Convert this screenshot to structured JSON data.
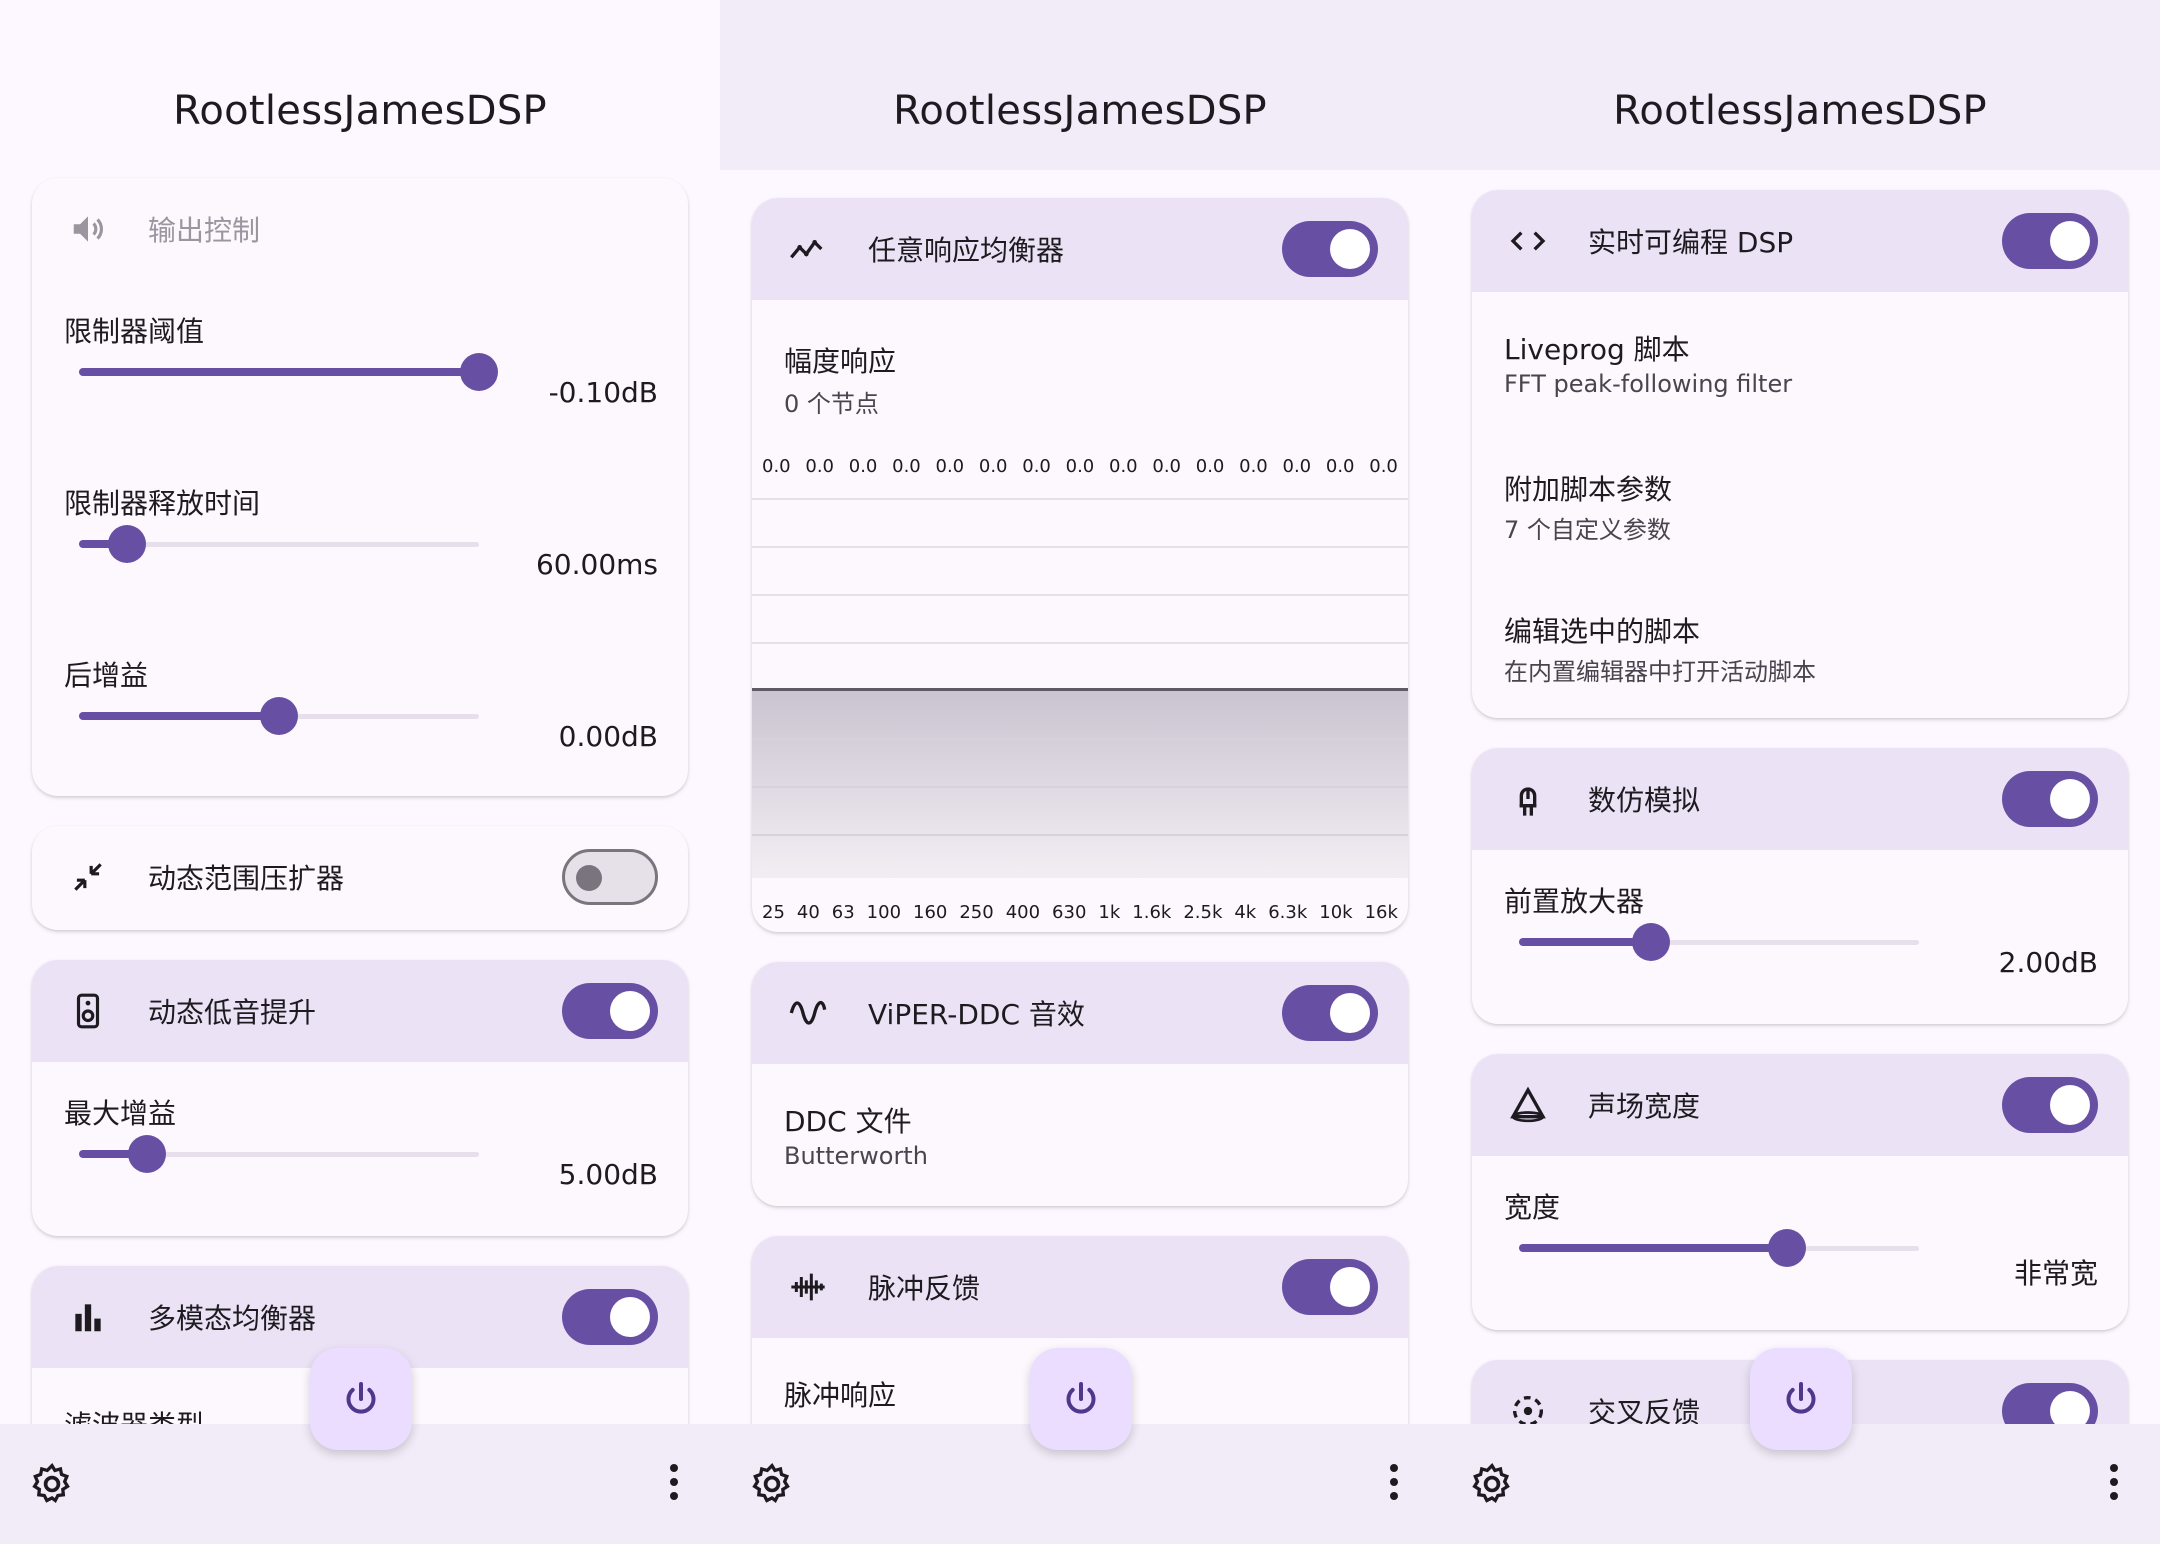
{
  "app_title": "RootlessJamesDSP",
  "panel1": {
    "output_card": {
      "title": "输出控制",
      "limiter_threshold": {
        "label": "限制器阈值",
        "value": "-0.10dB",
        "fraction": 1.0
      },
      "limiter_release": {
        "label": "限制器释放时间",
        "value": "60.00ms",
        "fraction": 0.12
      },
      "post_gain": {
        "label": "后增益",
        "value": "0.00dB",
        "fraction": 0.5
      }
    },
    "compander": {
      "title": "动态范围压扩器",
      "enabled": false
    },
    "bass_boost": {
      "title": "动态低音提升",
      "enabled": true,
      "max_gain": {
        "label": "最大增益",
        "value": "5.00dB",
        "fraction": 0.17
      }
    },
    "multimodal_eq": {
      "title": "多模态均衡器",
      "enabled": true,
      "filter_type_label": "滤波器类型"
    }
  },
  "panel2": {
    "arbitrary_eq": {
      "title": "任意响应均衡器",
      "enabled": true,
      "magnitude_label": "幅度响应",
      "nodes": "0 个节点",
      "gain_values": [
        "0.0",
        "0.0",
        "0.0",
        "0.0",
        "0.0",
        "0.0",
        "0.0",
        "0.0",
        "0.0",
        "0.0",
        "0.0",
        "0.0",
        "0.0",
        "0.0",
        "0.0"
      ],
      "freq_labels": [
        "25",
        "40",
        "63",
        "100",
        "160",
        "250",
        "400",
        "630",
        "1k",
        "1.6k",
        "2.5k",
        "4k",
        "6.3k",
        "10k",
        "16k"
      ]
    },
    "viper_ddc": {
      "title": "ViPER-DDC 音效",
      "enabled": true,
      "file_label": "DDC 文件",
      "file_value": "Butterworth"
    },
    "convolver": {
      "title": "脉冲反馈",
      "enabled": true,
      "impulse_label": "脉冲响应"
    }
  },
  "panel3": {
    "liveprog": {
      "title": "实时可编程 DSP",
      "enabled": true,
      "script_label": "Liveprog 脚本",
      "script_value": "FFT peak-following filter",
      "params_label": "附加脚本参数",
      "params_value": "7 个自定义参数",
      "edit_label": "编辑选中的脚本",
      "edit_value": "在内置编辑器中打开活动脚本"
    },
    "analog": {
      "title": "数仿模拟",
      "enabled": true,
      "preamp": {
        "label": "前置放大器",
        "value": "2.00dB",
        "fraction": 0.33
      }
    },
    "stereo_wide": {
      "title": "声场宽度",
      "enabled": true,
      "width": {
        "label": "宽度",
        "value": "非常宽",
        "fraction": 0.67
      }
    },
    "crossfeed": {
      "title": "交叉反馈",
      "enabled": true
    }
  },
  "colors": {
    "accent": "#6750a4",
    "card_header": "#ebe3f5",
    "fab": "#eaddff",
    "bar": "#f2ecf9"
  },
  "icons": [
    "volume-icon",
    "compress-icon",
    "speaker-icon",
    "equalizer-icon",
    "trend-icon",
    "wave-icon",
    "waveform-icon",
    "code-icon",
    "tube-icon",
    "triangle-icon",
    "crossfeed-icon",
    "power-icon",
    "gear-icon",
    "more-vert-icon"
  ]
}
